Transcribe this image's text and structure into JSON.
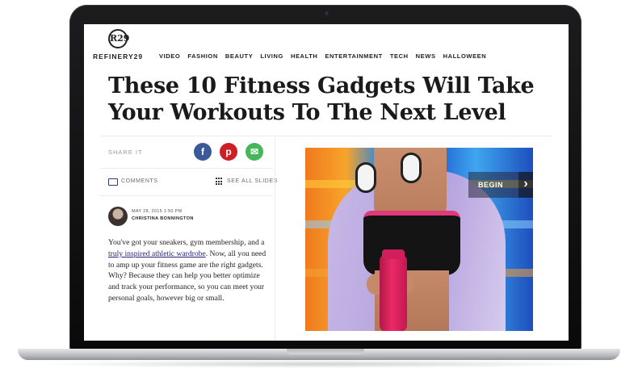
{
  "site": {
    "brand": "REFINERY29",
    "logo_text": "R29",
    "nav": [
      "VIDEO",
      "FASHION",
      "BEAUTY",
      "LIVING",
      "HEALTH",
      "ENTERTAINMENT",
      "TECH",
      "NEWS",
      "HALLOWEEN"
    ]
  },
  "article": {
    "headline": "These 10 Fitness Gadgets Will Take Your Workouts To The Next Level",
    "share_label": "SHARE IT",
    "share_icons": [
      "facebook-icon",
      "pinterest-icon",
      "email-icon"
    ],
    "comments_label": "COMMENTS",
    "slides_label": "SEE ALL SLIDES",
    "date": "MAY 28, 2015 1:50 PM",
    "author": "CHRISTINA BONNINGTON",
    "body_before": "You've got your sneakers, gym membership, and a ",
    "body_link": "truly inspired athletic wardrobe",
    "body_after": ". Now, all you need to amp up your fitness game are the right gadgets. Why? Because they can help you better optimize and track your performance, so you can meet your personal goals, however big or small."
  },
  "slideshow": {
    "begin_label": "BEGIN",
    "arrow": "›"
  },
  "colors": {
    "facebook": "#3b5998",
    "pinterest": "#cb2027",
    "email": "#43b75a",
    "link": "#23237e"
  }
}
